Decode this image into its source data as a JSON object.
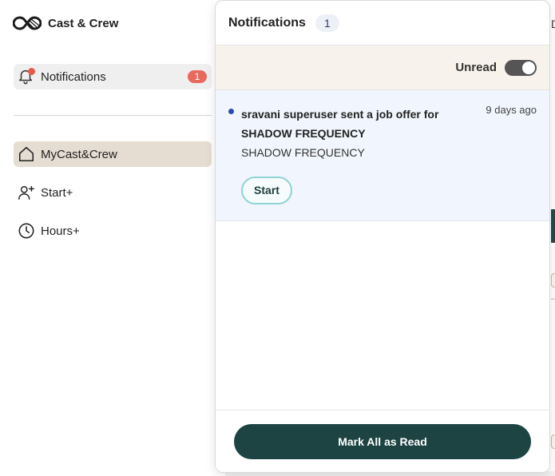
{
  "brand": {
    "name": "Cast & Crew"
  },
  "sidebar": {
    "notifications": {
      "label": "Notifications",
      "badge": "1"
    },
    "items": [
      {
        "label": "MyCast&Crew",
        "icon": "home-icon",
        "active": true
      },
      {
        "label": "Start+",
        "icon": "add-user-icon",
        "active": false
      },
      {
        "label": "Hours+",
        "icon": "clock-icon",
        "active": false
      }
    ]
  },
  "panel": {
    "title": "Notifications",
    "count": "1",
    "filter_label": "Unread",
    "notifications": [
      {
        "message": "sravani superuser sent a job offer for SHADOW FREQUENCY",
        "time": "9 days ago",
        "subtitle": "SHADOW FREQUENCY",
        "action_label": "Start"
      }
    ],
    "mark_all_label": "Mark All as Read"
  },
  "background": {
    "peek_letter": "D"
  },
  "colors": {
    "accent": "#1d4443",
    "badge": "#e8695e",
    "active_nav": "#e6ddd2",
    "unread_dot": "#2a4bb5"
  }
}
